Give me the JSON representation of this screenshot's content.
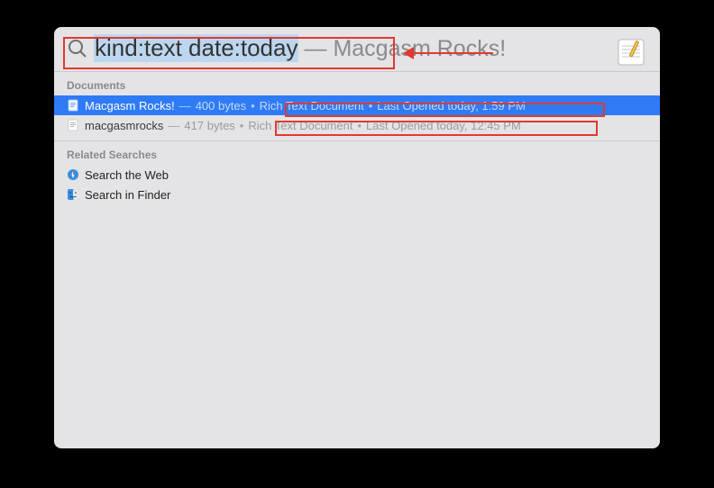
{
  "search": {
    "query": "kind:text date:today",
    "suggestion_prefix": "—",
    "suggestion": "Macgasm Rocks!"
  },
  "sections": {
    "documents_label": "Documents",
    "related_label": "Related Searches"
  },
  "documents": [
    {
      "name": "Macgasm Rocks!",
      "size": "400 bytes",
      "kind": "Rich Text Document",
      "opened": "Last Opened today, 1:59 PM",
      "selected": true
    },
    {
      "name": "macgasmrocks",
      "size": "417 bytes",
      "kind": "Rich Text Document",
      "opened": "Last Opened today, 12:45 PM",
      "selected": false
    }
  ],
  "related": [
    {
      "label": "Search the Web",
      "icon": "safari-icon"
    },
    {
      "label": "Search in Finder",
      "icon": "finder-icon"
    }
  ],
  "top_hit_icon": "textedit-icon"
}
